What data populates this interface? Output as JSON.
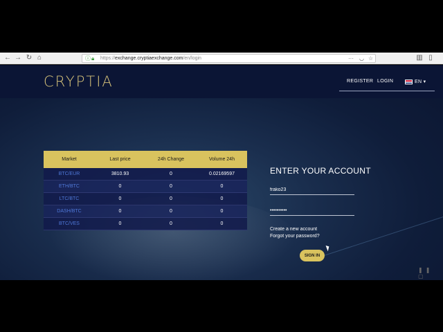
{
  "browser": {
    "url_prefix": "https://",
    "url_host": "exchange.cryptiaexchange.com",
    "url_path": "/en/login"
  },
  "header": {
    "logo": "CRYPTIA",
    "register": "REGISTER",
    "login": "LOGIN",
    "language": "EN"
  },
  "market": {
    "columns": [
      "Market",
      "Last price",
      "24h Change",
      "Volume 24h"
    ],
    "rows": [
      {
        "pair": "BTC/EUR",
        "last": "3810.93",
        "change": "0",
        "volume": "0.02169597"
      },
      {
        "pair": "ETH/BTC",
        "last": "0",
        "change": "0",
        "volume": "0"
      },
      {
        "pair": "LTC/BTC",
        "last": "0",
        "change": "0",
        "volume": "0"
      },
      {
        "pair": "DASH/BTC",
        "last": "0",
        "change": "0",
        "volume": "0"
      },
      {
        "pair": "BTC/VES",
        "last": "0",
        "change": "0",
        "volume": "0"
      }
    ]
  },
  "login": {
    "title": "ENTER YOUR ACCOUNT",
    "username": "frako23",
    "password": "••••••••••",
    "create_account": "Create a new account",
    "forgot_password": "Forgot your password?",
    "signin": "SIGN IN"
  },
  "colors": {
    "accent_gold": "#d9c35e",
    "header_bg": "#0b1535",
    "pair_link": "#4f78d8"
  }
}
